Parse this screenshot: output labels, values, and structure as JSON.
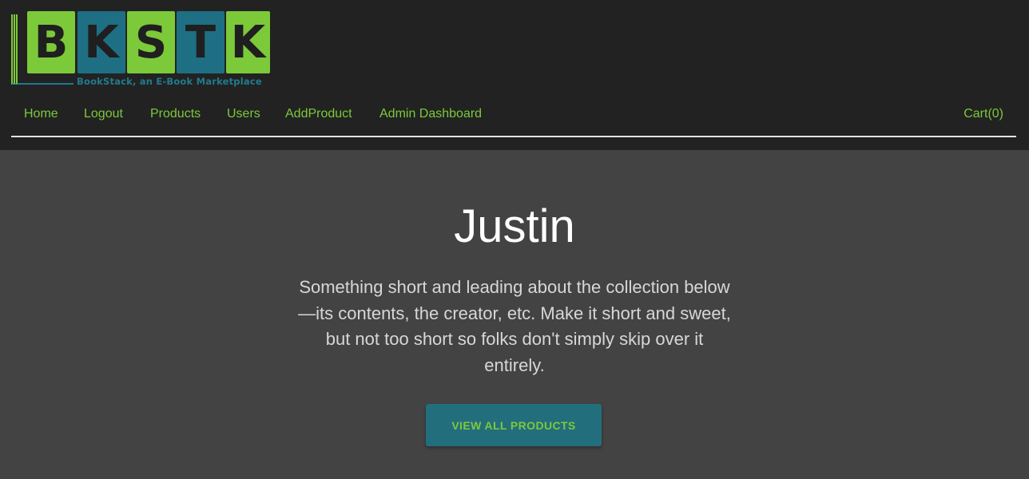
{
  "logo": {
    "letters": [
      "B",
      "K",
      "S",
      "T",
      "K"
    ],
    "tagline": "BookStack, an E-Book Marketplace",
    "colors": {
      "green": "#7cc93a",
      "teal": "#1e6f83"
    }
  },
  "nav": {
    "items": [
      {
        "label": "Home"
      },
      {
        "label": "Logout"
      },
      {
        "label": "Products"
      },
      {
        "label": "Users"
      },
      {
        "label": "AddProduct"
      },
      {
        "label": "Admin Dashboard"
      }
    ],
    "cart_label": "Cart(0)"
  },
  "hero": {
    "title": "Justin",
    "text": "Something short and leading about the collection below—its contents, the creator, etc. Make it short and sweet, but not too short so folks don't simply skip over it entirely.",
    "button_label": "VIEW ALL PRODUCTS"
  },
  "colors": {
    "header_bg": "#222222",
    "page_bg": "#434343",
    "accent_green": "#7cc93a",
    "button_bg": "#236e7d"
  }
}
